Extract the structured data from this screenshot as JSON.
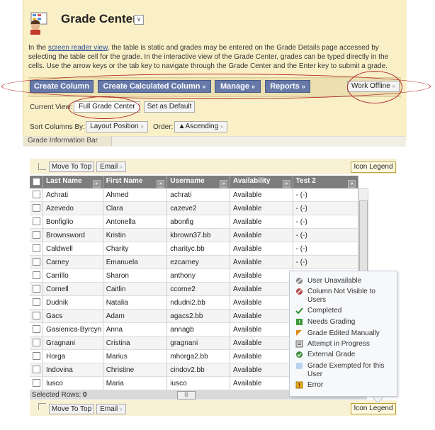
{
  "header": {
    "title": "Grade Center",
    "title_menu_icon": "chevron-down-icon",
    "page_icon": "gradebook-icon"
  },
  "description": {
    "before_link": "In the ",
    "link": "screen reader view",
    "after_link": ", the table is static and grades may be entered on the Grade Details page accessed by selecting the table cell for the grade. In the interactive view of the Grade Center, grades can be typed directly in the cells. Use the arrow keys or the tab key to navigate through the Grade Center and the Enter key to submit a grade."
  },
  "toolbar": {
    "create_column": "Create Column",
    "create_calculated_column": "Create Calculated Column",
    "manage": "Manage",
    "reports": "Reports",
    "work_offline": "Work Offline"
  },
  "view": {
    "current_view_label": "Current View:",
    "current_view_value": "Full Grade Center",
    "set_default": "Set as Default",
    "sort_label": "Sort Columns By:",
    "sort_value": "Layout Position",
    "order_label": "Order:",
    "order_value": "▲Ascending"
  },
  "info_bar": "Grade Information Bar",
  "grid_tools": {
    "move_to_top": "Move To Top",
    "email": "Email",
    "icon_legend": "Icon Legend"
  },
  "table": {
    "columns": [
      "Last Name",
      "First Name",
      "Username",
      "Availability",
      "Test 2"
    ],
    "rows": [
      [
        "Achrati",
        "Ahmed",
        "achrati",
        "Available",
        "- (-)"
      ],
      [
        "Azevedo",
        "Clara",
        "cazeve2",
        "Available",
        "- (-)"
      ],
      [
        "Bonfiglio",
        "Antonella",
        "abonfig",
        "Available",
        "- (-)"
      ],
      [
        "Brownsword",
        "Kristin",
        "kbrown37.bb",
        "Available",
        "- (-)"
      ],
      [
        "Caldwell",
        "Charity",
        "charityc.bb",
        "Available",
        "- (-)"
      ],
      [
        "Carney",
        "Emanuela",
        "ezcarney",
        "Available",
        "- (-)"
      ],
      [
        "Carrillo",
        "Sharon",
        "anthony",
        "Available",
        ""
      ],
      [
        "Cornell",
        "Caitlin",
        "ccorne2",
        "Available",
        ""
      ],
      [
        "Dudnik",
        "Natalia",
        "ndudni2.bb",
        "Available",
        ""
      ],
      [
        "Gacs",
        "Adam",
        "agacs2.bb",
        "Available",
        ""
      ],
      [
        "Gasienica-Byrcyn",
        "Anna",
        "annagb",
        "Available",
        ""
      ],
      [
        "Gragnani",
        "Cristina",
        "gragnani",
        "Available",
        ""
      ],
      [
        "Horga",
        "Marius",
        "mhorga2.bb",
        "Available",
        ""
      ],
      [
        "Indovina",
        "Christine",
        "cindov2.bb",
        "Available",
        ""
      ],
      [
        "Iusco",
        "Maria",
        "iusco",
        "Available",
        ""
      ]
    ],
    "selected_rows_label": "Selected Rows:",
    "selected_rows_count": "0"
  },
  "legend": {
    "items": [
      {
        "icon": "user-unavailable-icon",
        "label": "User Unavailable",
        "color": "#8a8a8a"
      },
      {
        "icon": "column-not-visible-icon",
        "label": "Column Not Visible to Users",
        "color": "#b04a4a"
      },
      {
        "icon": "completed-check-icon",
        "label": "Completed",
        "color": "#2f8f2f"
      },
      {
        "icon": "needs-grading-icon",
        "label": "Needs Grading",
        "color": "#3a9a3a"
      },
      {
        "icon": "grade-edited-icon",
        "label": "Grade Edited Manually",
        "color": "#e08a1a"
      },
      {
        "icon": "attempt-in-progress-icon",
        "label": "Attempt in Progress",
        "color": "#6a6a6a"
      },
      {
        "icon": "external-grade-icon",
        "label": "External Grade",
        "color": "#3a8a3a"
      },
      {
        "icon": "grade-exempted-icon",
        "label": "Grade Exempted for this User",
        "color": "#8fb7e0"
      },
      {
        "icon": "error-icon",
        "label": "Error",
        "color": "#e0b020"
      }
    ]
  }
}
